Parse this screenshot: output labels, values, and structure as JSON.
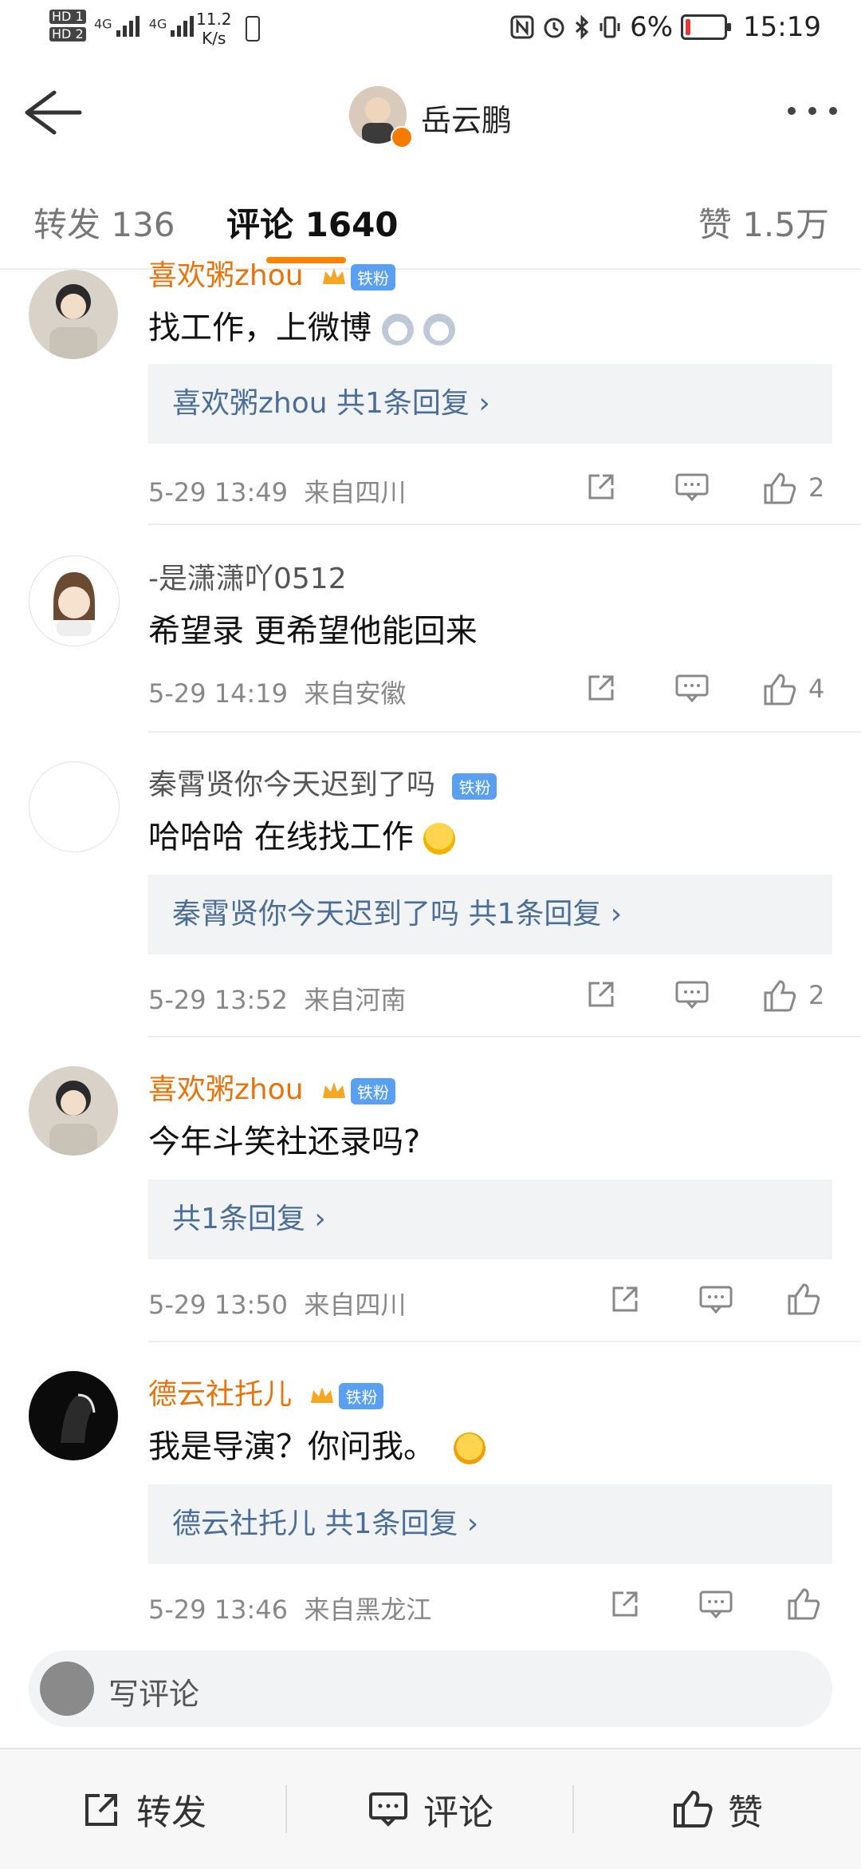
{
  "status_bar": {
    "hd1": "HD 1",
    "hd2": "HD 2",
    "net1": "4G",
    "net2": "4G",
    "speed_value": "11.2",
    "speed_unit": "K/s",
    "battery": "6%",
    "time": "15:19"
  },
  "nav": {
    "title": "岳云鹏"
  },
  "tabs": [
    {
      "label": "转发 136"
    },
    {
      "label": "评论 1640"
    },
    {
      "label": "赞 1.5万"
    }
  ],
  "badges": {
    "fan": "铁粉"
  },
  "comments": [
    {
      "name": "喜欢粥zhou",
      "text": "找工作，上微博",
      "reply": "喜欢粥zhou  共1条回复 ›",
      "time": "5-29 13:49",
      "location": "来自四川",
      "likes": "2"
    },
    {
      "name": "-是潇潇吖0512",
      "text": "希望录 更希望他能回来",
      "time": "5-29 14:19",
      "location": "来自安徽",
      "likes": "4"
    },
    {
      "name": "秦霄贤你今天迟到了吗",
      "text": "哈哈哈 在线找工作",
      "reply": "秦霄贤你今天迟到了吗  共1条回复 ›",
      "time": "5-29 13:52",
      "location": "来自河南",
      "likes": "2"
    },
    {
      "name": "喜欢粥zhou",
      "text": "今年斗笑社还录吗?",
      "reply": "共1条回复 ›",
      "time": "5-29 13:50",
      "location": "来自四川",
      "likes": ""
    },
    {
      "name": "德云社托儿",
      "text": "我是导演？你问我。",
      "reply": "德云社托儿  共1条回复 ›",
      "time": "5-29 13:46",
      "location": "来自黑龙江",
      "likes": ""
    }
  ],
  "write_comment": {
    "placeholder": "写评论"
  },
  "bottom_bar": {
    "repost": "转发",
    "comment": "评论",
    "like": "赞"
  },
  "colors": {
    "accent": "#ff8200",
    "link": "#4a6d9a",
    "vip_name": "#e8730a",
    "fan_badge": "#5aa0f2"
  }
}
